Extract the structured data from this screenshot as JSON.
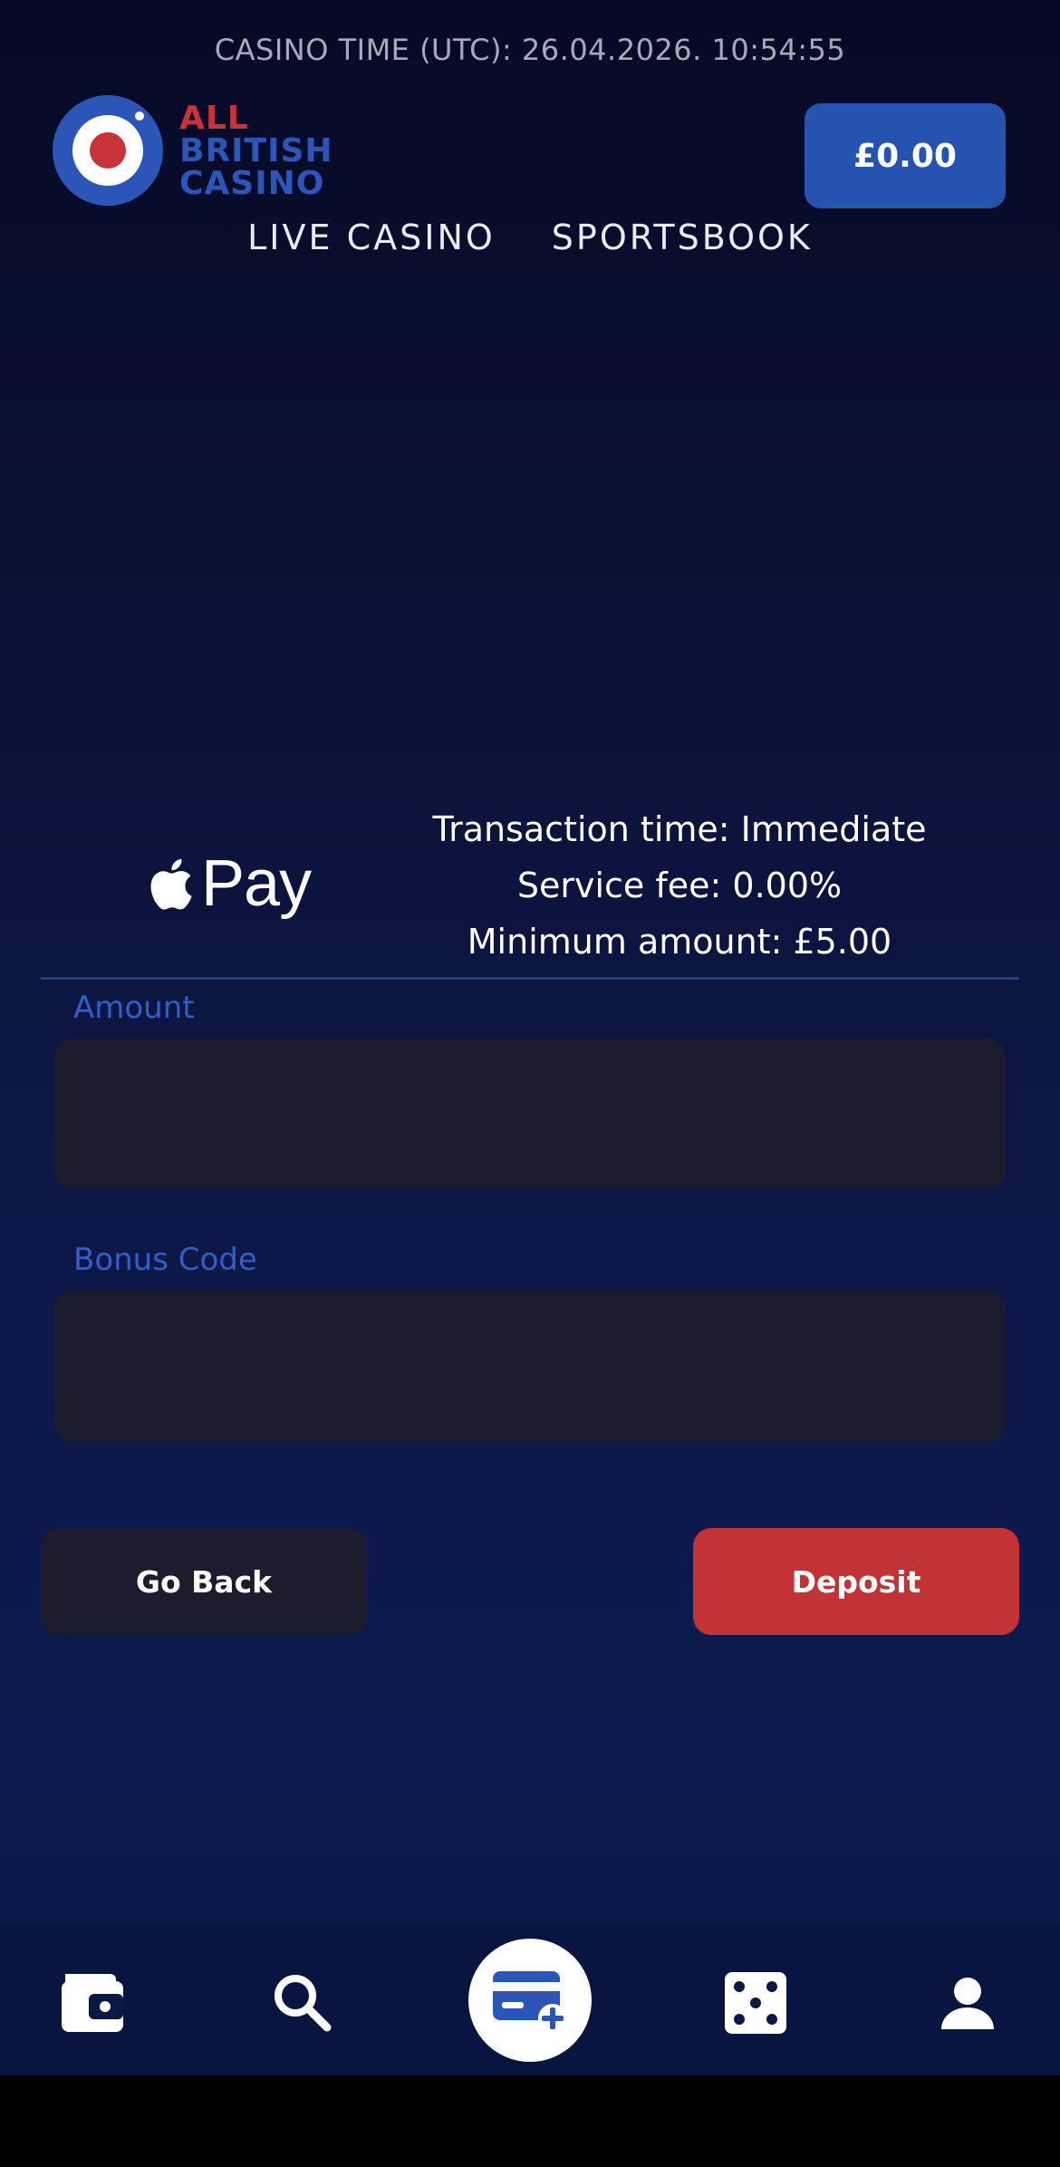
{
  "header": {
    "casino_time": "CASINO TIME (UTC): 26.04.2026. 10:54:55",
    "logo": {
      "line1": "ALL",
      "line2": "BRITISH",
      "line3": "CASINO"
    },
    "balance": "£0.00"
  },
  "nav": {
    "items": [
      "LIVE CASINO",
      "SPORTSBOOK"
    ]
  },
  "payment": {
    "method_label": "Pay",
    "transaction_time": "Transaction time: Immediate",
    "service_fee": "Service fee: 0.00%",
    "minimum_amount": "Minimum amount: £5.00"
  },
  "form": {
    "amount_label": "Amount",
    "amount_value": "",
    "bonus_label": "Bonus Code",
    "bonus_value": ""
  },
  "buttons": {
    "back": "Go Back",
    "deposit": "Deposit"
  },
  "bottom_nav": {
    "icons": [
      "wallet-icon",
      "search-icon",
      "deposit-card-icon",
      "dice-icon",
      "user-icon"
    ]
  },
  "colors": {
    "accent_blue": "#2653b0",
    "deposit_red": "#c13335",
    "logo_red": "#c8333a",
    "label_blue": "#2f5fc7"
  }
}
